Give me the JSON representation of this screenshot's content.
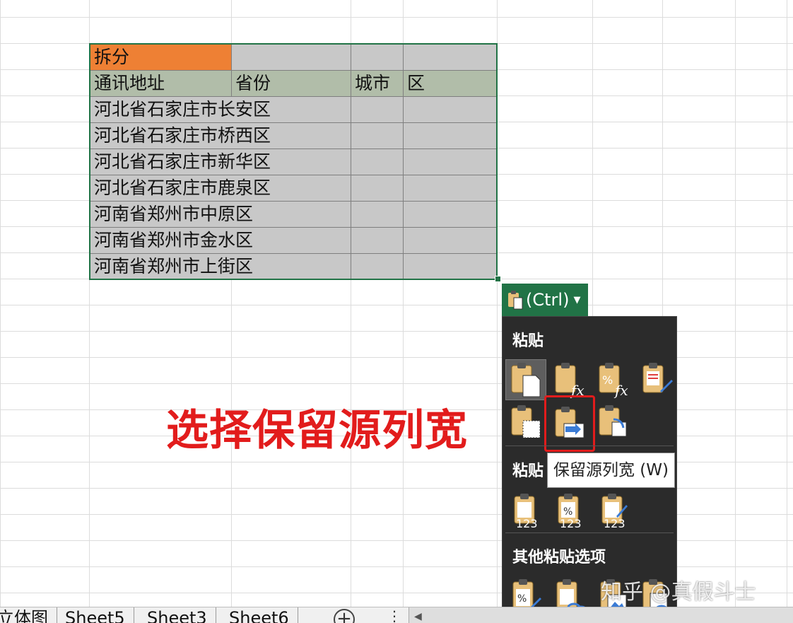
{
  "table": {
    "header1": "拆分",
    "header2": [
      "通讯地址",
      "省份",
      "城市",
      "区"
    ],
    "rows": [
      "河北省石家庄市长安区",
      "河北省石家庄市桥西区",
      "河北省石家庄市新华区",
      "河北省石家庄市鹿泉区",
      "河南省郑州市中原区",
      "河南省郑州市金水区",
      "河南省郑州市上街区"
    ]
  },
  "ctrl_button": {
    "label": "(Ctrl)",
    "icon": "clipboard-icon"
  },
  "paste_menu": {
    "section_paste": "粘贴",
    "section_paste_values": "粘贴",
    "section_other": "其他粘贴选项",
    "paste_icons": [
      "paste-icon",
      "paste-formulas-icon",
      "paste-formulas-number-format-icon",
      "paste-keep-source-formatting-icon",
      "paste-no-borders-icon",
      "paste-keep-source-column-widths-icon",
      "paste-transpose-icon"
    ],
    "value_icons": [
      "paste-values-icon",
      "paste-values-number-format-icon",
      "paste-values-source-formatting-icon"
    ],
    "other_icons": [
      "paste-formatting-icon",
      "paste-link-icon",
      "paste-picture-icon",
      "paste-linked-picture-icon"
    ]
  },
  "tooltip": "保留源列宽 (W)",
  "annotation": "选择保留源列宽",
  "watermark": "知乎 @真假斗士",
  "sheet_tabs": [
    "立体图",
    "Sheet5",
    "Sheet3",
    "Sheet6"
  ],
  "add_sheet_label": "+",
  "tab_menu_label": "⋮",
  "colors": {
    "accent_green": "#217346",
    "header_orange": "#ee8034",
    "header_green": "#b1bda9",
    "annotation_red": "#e21c1c",
    "menu_bg": "#2b2b2b"
  }
}
